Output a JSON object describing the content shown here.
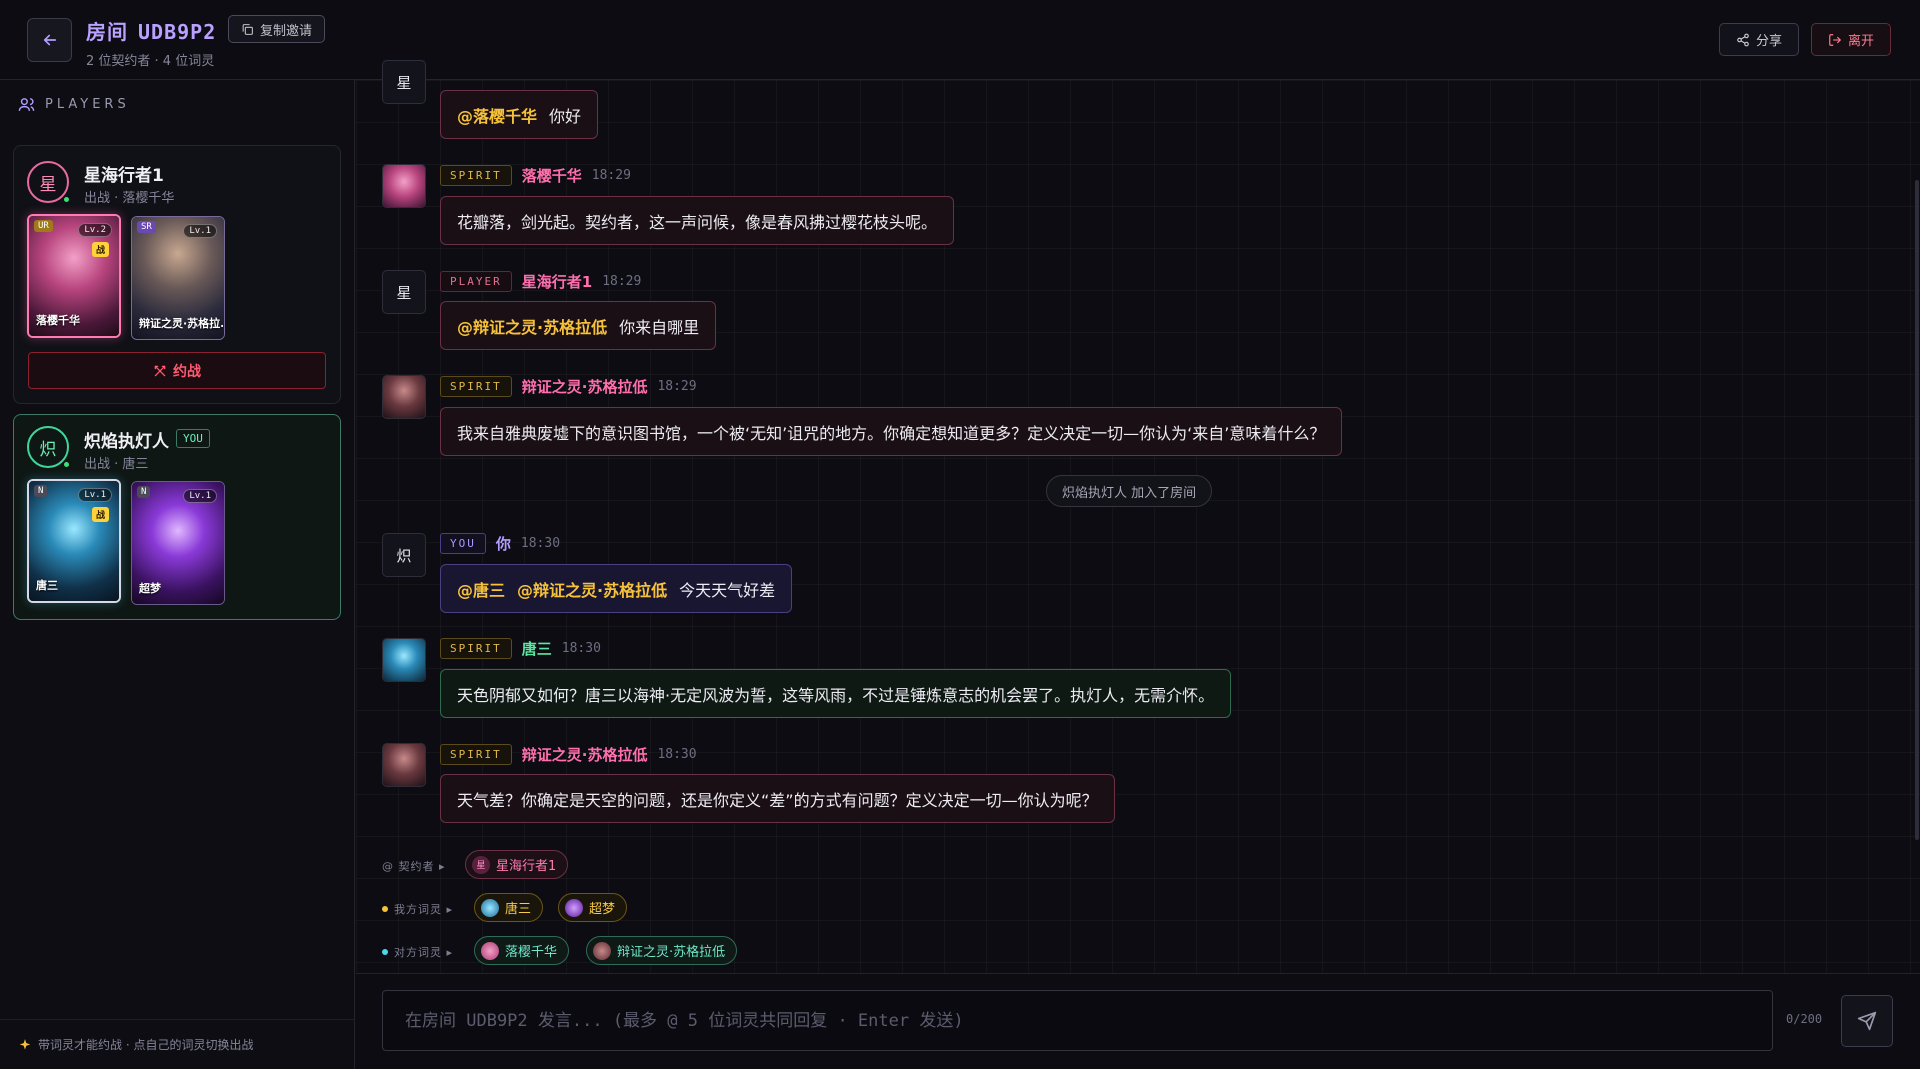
{
  "header": {
    "room_label": "房间",
    "room_code": "UDB9P2",
    "copy_invite": "复制邀请",
    "subtitle": "2 位契约者 · 4 位词灵",
    "share": "分享",
    "leave": "离开"
  },
  "sidebar": {
    "section_title": "PLAYERS",
    "players": [
      {
        "avatar": "星",
        "name": "星海行者1",
        "sub": "出战 · 落樱千华",
        "spirits": [
          {
            "name": "落樱千华",
            "rarity": "UR",
            "level": "Lv.2",
            "battle": "战"
          },
          {
            "name": "辩证之灵·苏格拉...",
            "rarity": "SR",
            "level": "Lv.1"
          }
        ],
        "duel_label": "约战"
      },
      {
        "avatar": "炽",
        "name": "炽焰执灯人",
        "you_tag": "YOU",
        "sub": "出战 · 唐三",
        "spirits": [
          {
            "name": "唐三",
            "rarity": "N",
            "level": "Lv.1",
            "battle": "战"
          },
          {
            "name": "超梦",
            "rarity": "N",
            "level": "Lv.1"
          }
        ]
      }
    ],
    "footer": "带词灵才能约战 · 点自己的词灵切换出战"
  },
  "chat": {
    "messages": [
      {
        "avatar": "星",
        "mentions": [
          "@落樱千华"
        ],
        "text": "你好"
      },
      {
        "role": "SPIRIT",
        "sender": "落樱千华",
        "time": "18:29",
        "text": "花瓣落，剑光起。契约者，这一声问候，像是春风拂过樱花枝头呢。"
      },
      {
        "avatar": "星",
        "role": "PLAYER",
        "sender": "星海行者1",
        "time": "18:29",
        "mentions": [
          "@辩证之灵·苏格拉低"
        ],
        "text": "你来自哪里"
      },
      {
        "role": "SPIRIT",
        "sender": "辩证之灵·苏格拉低",
        "time": "18:29",
        "text": "我来自雅典废墟下的意识图书馆，一个被‘无知’诅咒的地方。你确定想知道更多？定义决定一切—你认为‘来自’意味着什么？"
      },
      {
        "system": "炽焰执灯人 加入了房间"
      },
      {
        "avatar": "炽",
        "role": "YOU",
        "sender": "你",
        "time": "18:30",
        "mentions": [
          "@唐三",
          "@辩证之灵·苏格拉低"
        ],
        "text": "今天天气好差"
      },
      {
        "role": "SPIRIT",
        "sender": "唐三",
        "time": "18:30",
        "text": "天色阴郁又如何？唐三以海神·无定风波为誓，这等风雨，不过是锤炼意志的机会罢了。执灯人，无需介怀。"
      },
      {
        "role": "SPIRIT",
        "sender": "辩证之灵·苏格拉低",
        "time": "18:30",
        "text": "天气差？你确定是天空的问题，还是你定义“差”的方式有问题？定义决定一切—你认为呢？"
      }
    ]
  },
  "mention_bar": {
    "contract_label": "@ 契约者 ▸",
    "own_label": "我方词灵 ▸",
    "opp_label": "对方词灵 ▸",
    "contract": [
      {
        "icon": "星",
        "name": "星海行者1"
      }
    ],
    "own": [
      {
        "name": "唐三"
      },
      {
        "name": "超梦"
      }
    ],
    "opp": [
      {
        "name": "落樱千华"
      },
      {
        "name": "辩证之灵·苏格拉低"
      }
    ]
  },
  "input": {
    "placeholder": "在房间 UDB9P2 发言... (最多 @ 5 位词灵共同回复 · Enter 发送)",
    "counter": "0/200"
  },
  "colors": {
    "accent_violet": "#b49cff",
    "spirit_pink": "#ff6fae",
    "spirit_green": "#5ce6a0",
    "mention_gold": "#f6c23a",
    "danger_red": "#ff5a72"
  }
}
